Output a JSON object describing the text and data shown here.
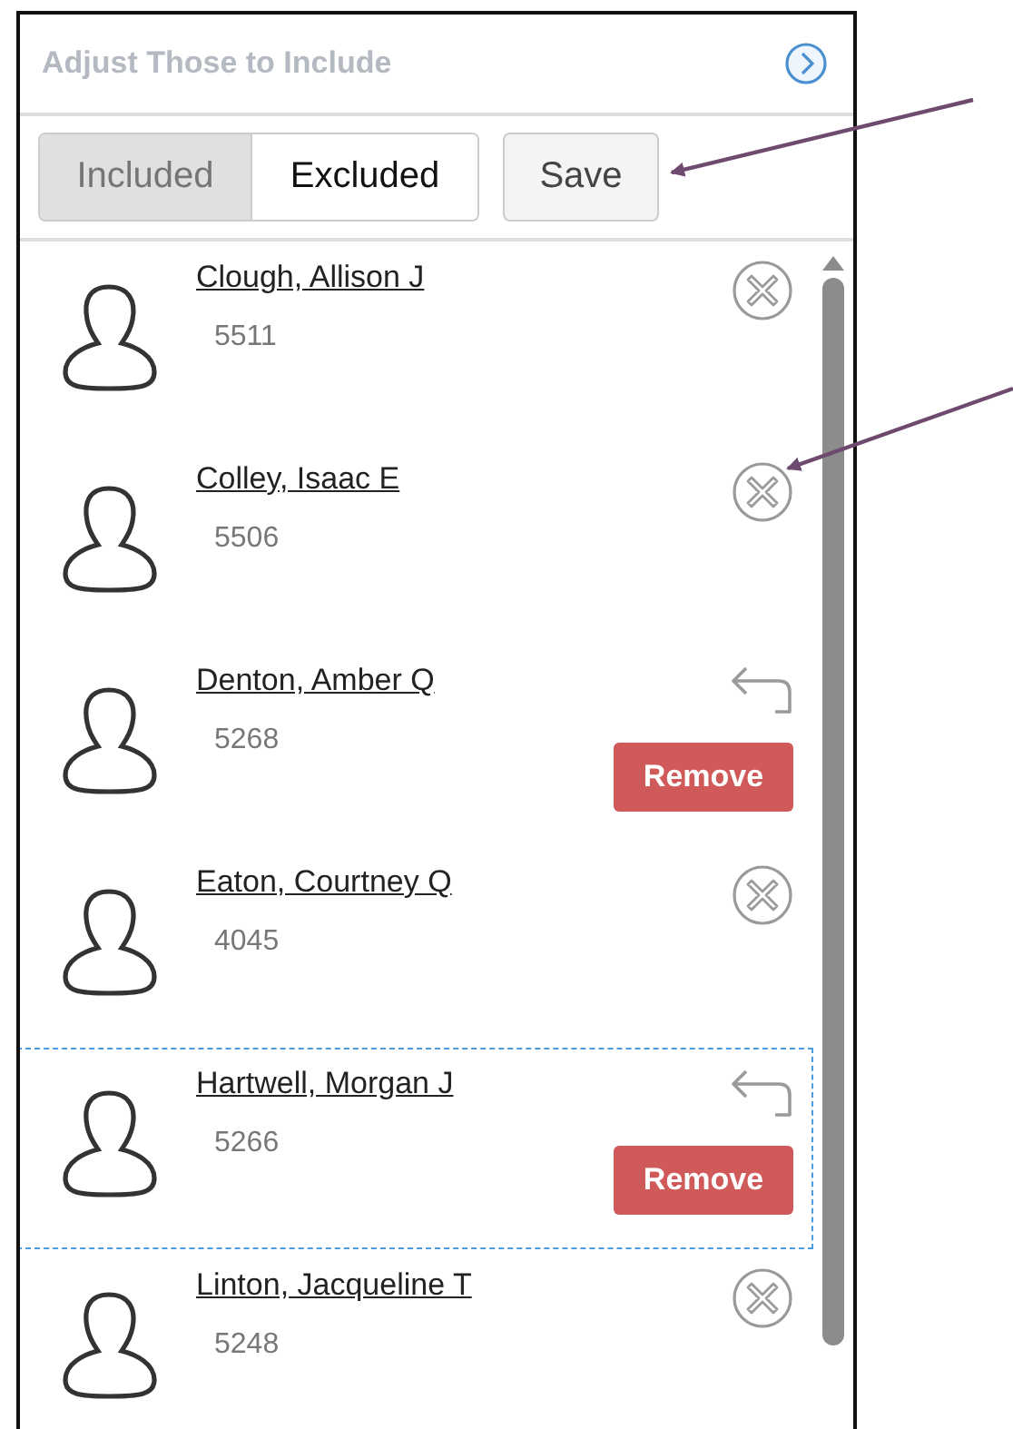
{
  "panel": {
    "title": "Adjust Those to Include",
    "filter_tabs": [
      {
        "label": "Included",
        "selected": true
      },
      {
        "label": "Excluded",
        "selected": false
      }
    ],
    "save_button": "Save"
  },
  "people": [
    {
      "name": "Clough, Allison J",
      "id": "5511",
      "pending_removal": false,
      "focused": false
    },
    {
      "name": "Colley, Isaac E",
      "id": "5506",
      "pending_removal": false,
      "focused": false
    },
    {
      "name": "Denton, Amber Q",
      "id": "5268",
      "pending_removal": true,
      "remove_button": "Remove",
      "focused": false
    },
    {
      "name": "Eaton, Courtney Q",
      "id": "4045",
      "pending_removal": false,
      "focused": false
    },
    {
      "name": "Hartwell, Morgan J",
      "id": "5266",
      "pending_removal": true,
      "remove_button": "Remove",
      "focused": true
    },
    {
      "name": "Linton, Jacqueline T",
      "id": "5248",
      "pending_removal": false,
      "focused": false
    }
  ]
}
